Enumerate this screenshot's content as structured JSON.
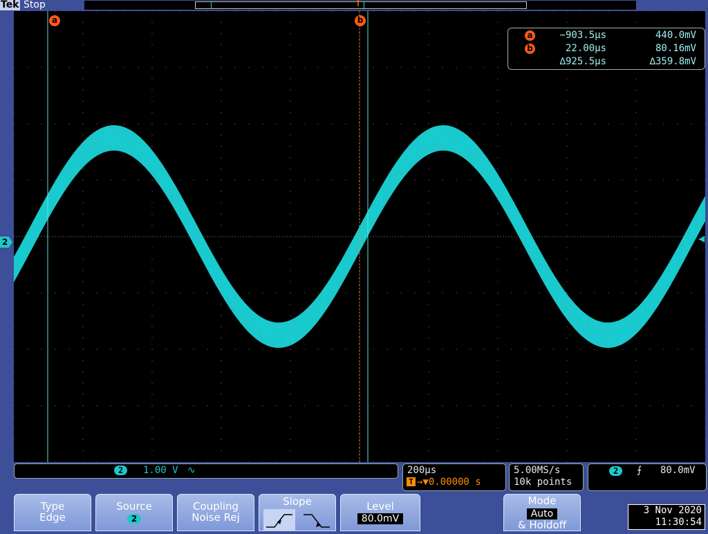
{
  "header": {
    "brand": "Tek",
    "run_state": "Stop",
    "trigger_position_marker": "T"
  },
  "waveform": {
    "channel": "2",
    "cycles_visible": 2.1,
    "amplitude_divisions": 1.75,
    "noise_band_divisions": 0.45,
    "color": "#1cc8cc"
  },
  "cursors": {
    "a_label": "a",
    "b_label": "b",
    "line_color": "#60e0e0"
  },
  "cursor_readout": {
    "a": {
      "label": "a",
      "time": "−903.5µs",
      "value": "440.0mV"
    },
    "b": {
      "label": "b",
      "time": "22.00µs",
      "value": "80.16mV"
    },
    "delta": {
      "time": "∆925.5µs",
      "value": "∆359.8mV"
    }
  },
  "status": {
    "channel_label": "2",
    "scale": "1.00 V",
    "bandwidth_symbol": "∿",
    "timebase": "200µs",
    "trigger_icon": "T",
    "trigger_delay": "→▼0.00000 s",
    "sample_rate": "5.00MS/s",
    "record_length": "10k points",
    "trigger_channel": "2",
    "trigger_slope_symbol": "⨍",
    "trigger_level": "80.0mV"
  },
  "softkeys": {
    "type": {
      "label": "Type",
      "value": "Edge"
    },
    "source": {
      "label": "Source",
      "value": "2"
    },
    "coupling": {
      "label": "Coupling",
      "value": "Noise Rej"
    },
    "slope": {
      "label": "Slope"
    },
    "level": {
      "label": "Level",
      "value": "80.0mV"
    },
    "mode": {
      "label": "Mode",
      "value": "Auto",
      "suffix": "& Holdoff"
    }
  },
  "datetime": {
    "date": "3 Nov 2020",
    "time": "11:30:54"
  },
  "colors": {
    "accent": "#1cc8cc",
    "cursor_badge": "#ff5a1a",
    "trigger_orange": "#ff8c00",
    "bezel": "#3c4f98"
  }
}
